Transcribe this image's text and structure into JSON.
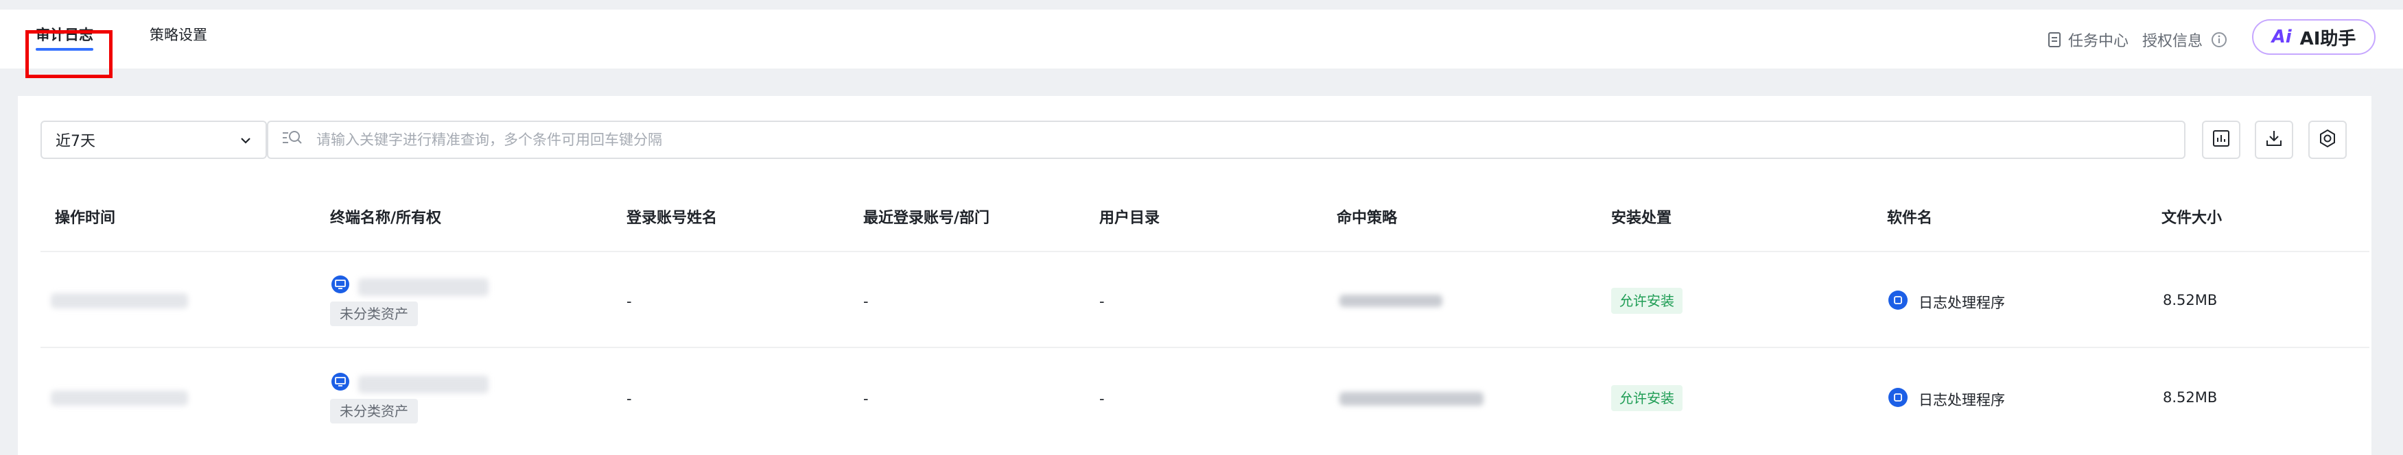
{
  "tabs": [
    {
      "label": "审计日志",
      "active": true
    },
    {
      "label": "策略设置",
      "active": false
    }
  ],
  "header_right": {
    "task_center": "任务中心",
    "license_info": "授权信息",
    "ai_assistant": "AI助手",
    "ai_mark": "Ai"
  },
  "filters": {
    "time_range": "近7天",
    "search_placeholder": "请输入关键字进行精准查询，多个条件可用回车键分隔"
  },
  "table": {
    "columns": [
      "操作时间",
      "终端名称/所有权",
      "登录账号姓名",
      "最近登录账号/部门",
      "用户目录",
      "命中策略",
      "安装处置",
      "软件名",
      "文件大小"
    ],
    "rows": [
      {
        "login_name": "-",
        "recent_account": "-",
        "user_dir": "-",
        "asset_tag": "未分类资产",
        "action": "允许安装",
        "software": "日志处理程序",
        "size": "8.52MB"
      },
      {
        "login_name": "-",
        "recent_account": "-",
        "user_dir": "-",
        "asset_tag": "未分类资产",
        "action": "允许安装",
        "software": "日志处理程序",
        "size": "8.52MB"
      }
    ]
  },
  "colors": {
    "accent": "#3370ff",
    "highlight_box": "#f00000",
    "allow_tag": "#1f9d55",
    "icon_blue": "#1c5fe6"
  },
  "icons": [
    "document-icon",
    "info-icon",
    "chevron-down-icon",
    "search-filter-icon",
    "chart-icon",
    "download-icon",
    "settings-icon",
    "monitor-icon",
    "software-icon"
  ]
}
